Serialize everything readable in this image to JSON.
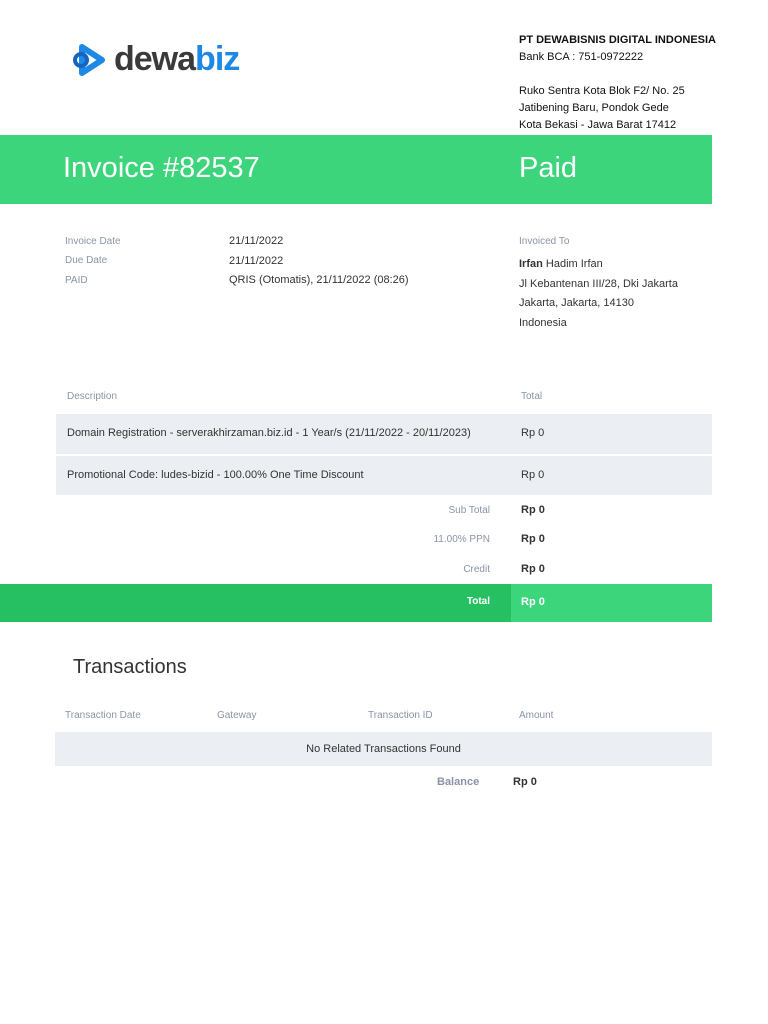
{
  "logo": {
    "text_a": "dewa",
    "text_b": "biz"
  },
  "company": {
    "name": "PT DEWABISNIS DIGITAL INDONESIA",
    "bank": "Bank BCA : 751-0972222",
    "addr1": "Ruko Sentra Kota Blok F2/ No. 25",
    "addr2": "Jatibening Baru, Pondok Gede",
    "addr3": "Kota Bekasi - Jawa Barat 17412"
  },
  "banner": {
    "title": "Invoice #82537",
    "status": "Paid",
    "color": "#3dd57b"
  },
  "info": {
    "invoice_date_label": "Invoice Date",
    "invoice_date": "21/11/2022",
    "due_date_label": "Due Date",
    "due_date": "21/11/2022",
    "paid_label": "PAID",
    "paid": "QRIS (Otomatis), 21/11/2022 (08:26)"
  },
  "invoiced_to": {
    "label": "Invoiced To",
    "first": "Irfan",
    "rest": " Hadim Irfan",
    "addr1": "Jl Kebantenan III/28, Dki Jakarta",
    "addr2": "Jakarta, Jakarta, 14130",
    "country": "Indonesia"
  },
  "items": {
    "h_desc": "Description",
    "h_total": "Total",
    "rows": [
      {
        "desc": "Domain Registration - serverakhirzaman.biz.id - 1 Year/s (21/11/2022 - 20/11/2023)",
        "total": "Rp 0"
      },
      {
        "desc": "Promotional Code: ludes-bizid - 100.00% One Time Discount",
        "total": "Rp 0"
      }
    ]
  },
  "summary": {
    "sub_label": "Sub Total",
    "sub": "Rp 0",
    "tax_label": "11.00% PPN",
    "tax": "Rp 0",
    "credit_label": "Credit",
    "credit": "Rp 0",
    "total_label": "Total",
    "total": "Rp 0"
  },
  "transactions": {
    "title": "Transactions",
    "h_date": "Transaction Date",
    "h_gateway": "Gateway",
    "h_id": "Transaction ID",
    "h_amount": "Amount",
    "empty": "No Related Transactions Found",
    "balance_label": "Balance",
    "balance": "Rp 0"
  }
}
